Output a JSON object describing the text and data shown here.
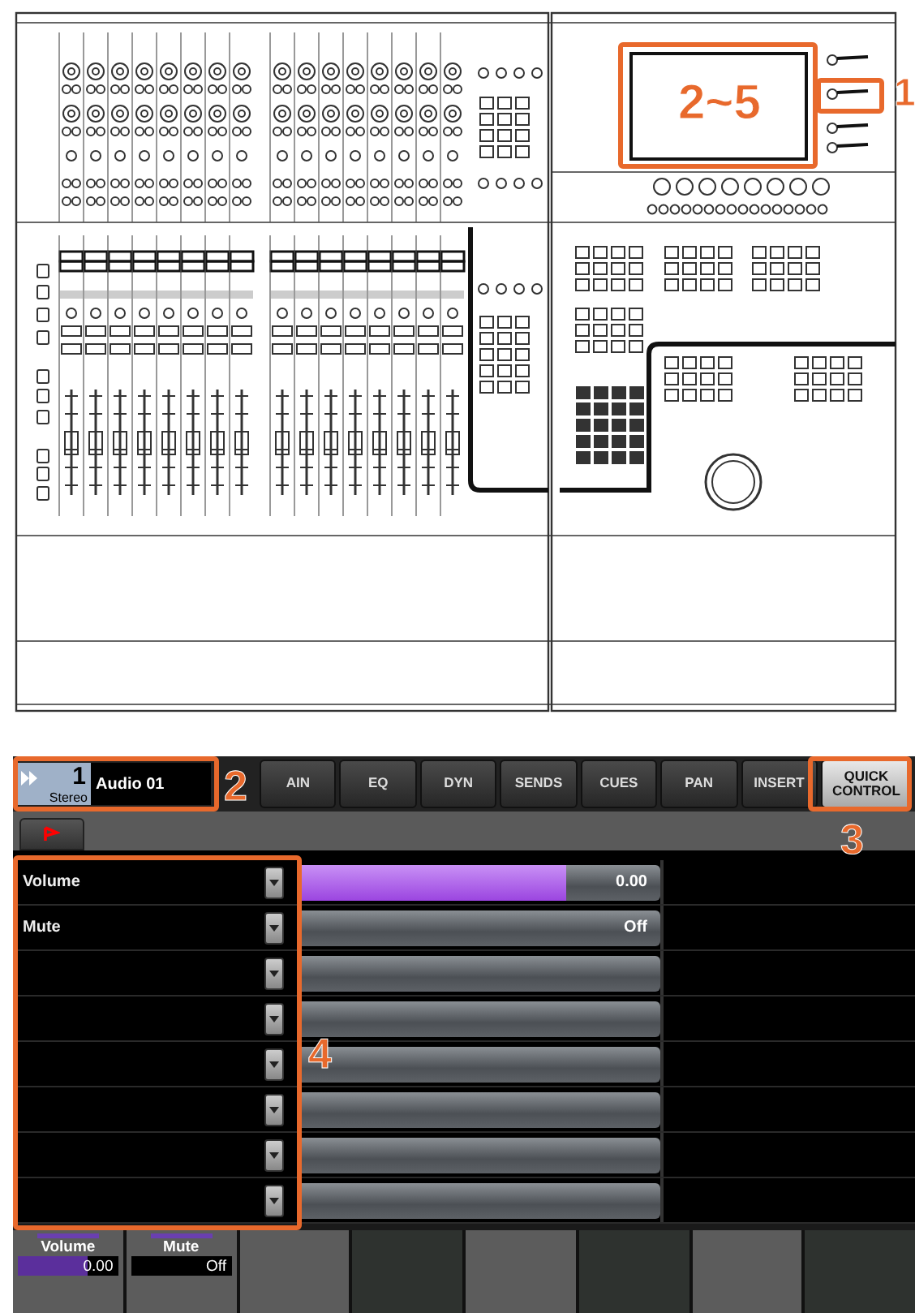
{
  "figure": {
    "callouts": [
      {
        "label": "2~5"
      },
      {
        "label": "1"
      }
    ]
  },
  "screen": {
    "track": {
      "number": "1",
      "format": "Stereo",
      "name": "Audio 01"
    },
    "tabs": [
      {
        "label": "AIN",
        "selected": false
      },
      {
        "label": "EQ",
        "selected": false
      },
      {
        "label": "DYN",
        "selected": false
      },
      {
        "label": "SENDS",
        "selected": false
      },
      {
        "label": "CUES",
        "selected": false
      },
      {
        "label": "PAN",
        "selected": false
      },
      {
        "label": "INSERT",
        "selected": false
      },
      {
        "label": "QUICK CONTROL",
        "selected": true
      }
    ],
    "params": [
      {
        "kind": "param",
        "name": "Volume",
        "value": "0.00",
        "level": 0.74
      },
      {
        "kind": "param",
        "name": "Mute",
        "value": "Off"
      },
      {
        "kind": "empty"
      },
      {
        "kind": "empty"
      },
      {
        "kind": "empty"
      },
      {
        "kind": "empty"
      },
      {
        "kind": "empty"
      },
      {
        "kind": "empty"
      }
    ],
    "strips": [
      {
        "name": "Volume",
        "value": "0.00",
        "level": 0.7
      },
      {
        "name": "Mute",
        "value": "Off"
      }
    ],
    "callouts": [
      {
        "label": "2"
      },
      {
        "label": "3"
      },
      {
        "label": "4"
      }
    ]
  }
}
